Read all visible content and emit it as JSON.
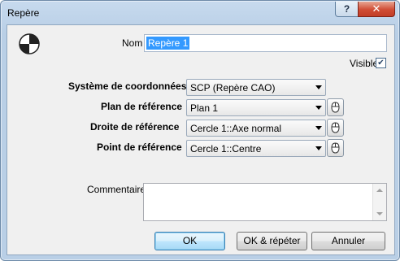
{
  "window": {
    "title": "Repère"
  },
  "titlebar": {
    "help_label": "?",
    "close_label": "✕"
  },
  "form": {
    "nom_label": "Nom",
    "nom_value": "Repère 1",
    "visible_label": "Visible",
    "visible_checked": true,
    "systeme_label": "Système de coordonnées",
    "systeme_value": "SCP (Repère CAO)",
    "plan_label": "Plan de référence",
    "plan_value": "Plan 1",
    "droite_label": "Droite de référence",
    "droite_value": "Cercle 1::Axe normal",
    "point_label": "Point de référence",
    "point_value": "Cercle 1::Centre",
    "commentaire_label": "Commentaire",
    "commentaire_value": ""
  },
  "buttons": {
    "ok": "OK",
    "ok_repeat": "OK & répéter",
    "cancel": "Annuler"
  },
  "icons": {
    "frame": "coordinate-frame-icon",
    "pick": "mouse-pick-icon"
  }
}
